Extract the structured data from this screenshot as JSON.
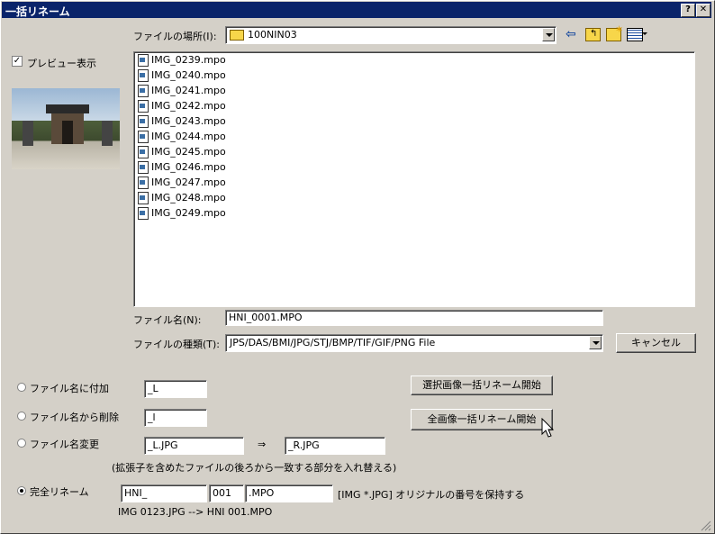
{
  "window": {
    "title": "一括リネーム",
    "help_label": "?",
    "close_label": "✕"
  },
  "location": {
    "label": "ファイルの場所(I):",
    "value": "100NIN03"
  },
  "toolbar": {
    "back_icon": "back-arrow-icon",
    "up_icon": "folder-up-icon",
    "newfolder_icon": "new-folder-icon",
    "view_icon": "view-menu-icon"
  },
  "preview": {
    "label": "プレビュー表示",
    "checked": true
  },
  "files": [
    "IMG_0239.mpo",
    "IMG_0240.mpo",
    "IMG_0241.mpo",
    "IMG_0242.mpo",
    "IMG_0243.mpo",
    "IMG_0244.mpo",
    "IMG_0245.mpo",
    "IMG_0246.mpo",
    "IMG_0247.mpo",
    "IMG_0248.mpo",
    "IMG_0249.mpo"
  ],
  "filename": {
    "label": "ファイル名(N):",
    "value": "HNI_0001.MPO"
  },
  "filetype": {
    "label": "ファイルの種類(T):",
    "value": "JPS/DAS/BMI/JPG/STJ/BMP/TIF/GIF/PNG File"
  },
  "cancel_label": "キャンセル",
  "options": {
    "append": {
      "label": "ファイル名に付加",
      "value": "_L"
    },
    "remove": {
      "label": "ファイル名から削除",
      "value": "_l"
    },
    "change": {
      "label": "ファイル名変更",
      "from": "_L.JPG",
      "arrow": "⇒",
      "to": "_R.JPG",
      "note": "(拡張子を含めたファイルの後ろから一致する部分を入れ替える)"
    },
    "full": {
      "label": "完全リネーム",
      "prefix": "HNI_",
      "number": "001",
      "ext": ".MPO",
      "keep_label": "[IMG *.JPG] オリジナルの番号を保持する",
      "example": "IMG 0123.JPG --> HNI 001.MPO"
    }
  },
  "buttons": {
    "selected": "選択画像一括リネーム開始",
    "all": "全画像一括リネーム開始"
  }
}
